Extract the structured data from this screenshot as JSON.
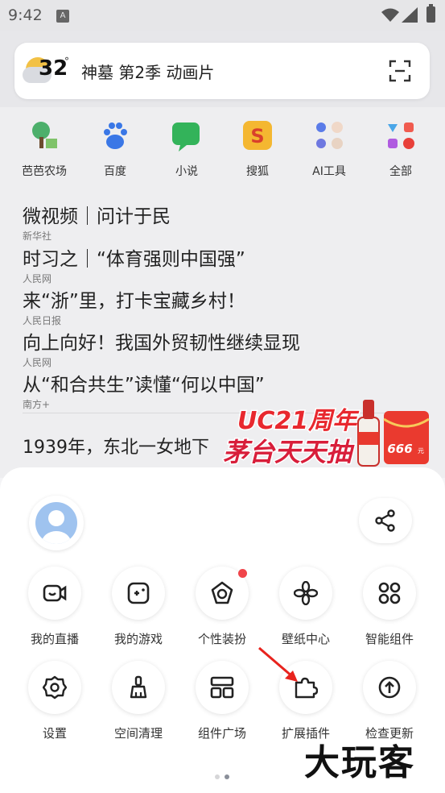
{
  "status_bar": {
    "time": "9:42",
    "sim_label": "A"
  },
  "search_bar": {
    "temperature": "32",
    "degree": "°",
    "query": "神墓 第2季 动画片"
  },
  "shortcuts": [
    {
      "label": "芭芭农场",
      "icon": "farm-tree-icon"
    },
    {
      "label": "百度",
      "icon": "baidu-paw-icon"
    },
    {
      "label": "小说",
      "icon": "novel-chat-icon"
    },
    {
      "label": "搜狐",
      "icon": "sohu-icon"
    },
    {
      "label": "AI工具",
      "icon": "ai-tools-grid-icon"
    },
    {
      "label": "全部",
      "icon": "all-apps-grid-icon"
    }
  ],
  "news": [
    {
      "headline": "微视频｜问计于民",
      "source": "新华社"
    },
    {
      "headline": "时习之｜“体育强则中国强”",
      "source": "人民网"
    },
    {
      "headline": "来“浙”里，打卡宝藏乡村！",
      "source": "人民日报"
    },
    {
      "headline": "向上向好！我国外贸韧性继续显现",
      "source": "人民网"
    },
    {
      "headline": "从“和合共生”读懂“何以中国”",
      "source": "南方+"
    }
  ],
  "feed_headline": "1939年，东北一女地下",
  "promo": {
    "line1": "UC21周年",
    "line2": "茅台天天抽",
    "envelope_value": "666",
    "envelope_unit": "元"
  },
  "menu": {
    "row1": [
      {
        "label": "我的直播",
        "icon": "live-camera-icon"
      },
      {
        "label": "我的游戏",
        "icon": "game-controller-icon"
      },
      {
        "label": "个性装扮",
        "icon": "theme-decorate-icon",
        "badge": true
      },
      {
        "label": "壁纸中心",
        "icon": "wallpaper-flower-icon"
      },
      {
        "label": "智能组件",
        "icon": "smart-widget-icon"
      }
    ],
    "row2": [
      {
        "label": "设置",
        "icon": "settings-gear-icon"
      },
      {
        "label": "空间清理",
        "icon": "broom-clean-icon"
      },
      {
        "label": "组件广场",
        "icon": "widget-layout-icon"
      },
      {
        "label": "扩展插件",
        "icon": "puzzle-plugin-icon"
      },
      {
        "label": "检查更新",
        "icon": "update-arrow-icon"
      }
    ]
  },
  "watermark": "大玩客",
  "colors": {
    "accent_red": "#f0444a",
    "promo_red": "#e8282e",
    "weather_sun": "#f2c145"
  }
}
